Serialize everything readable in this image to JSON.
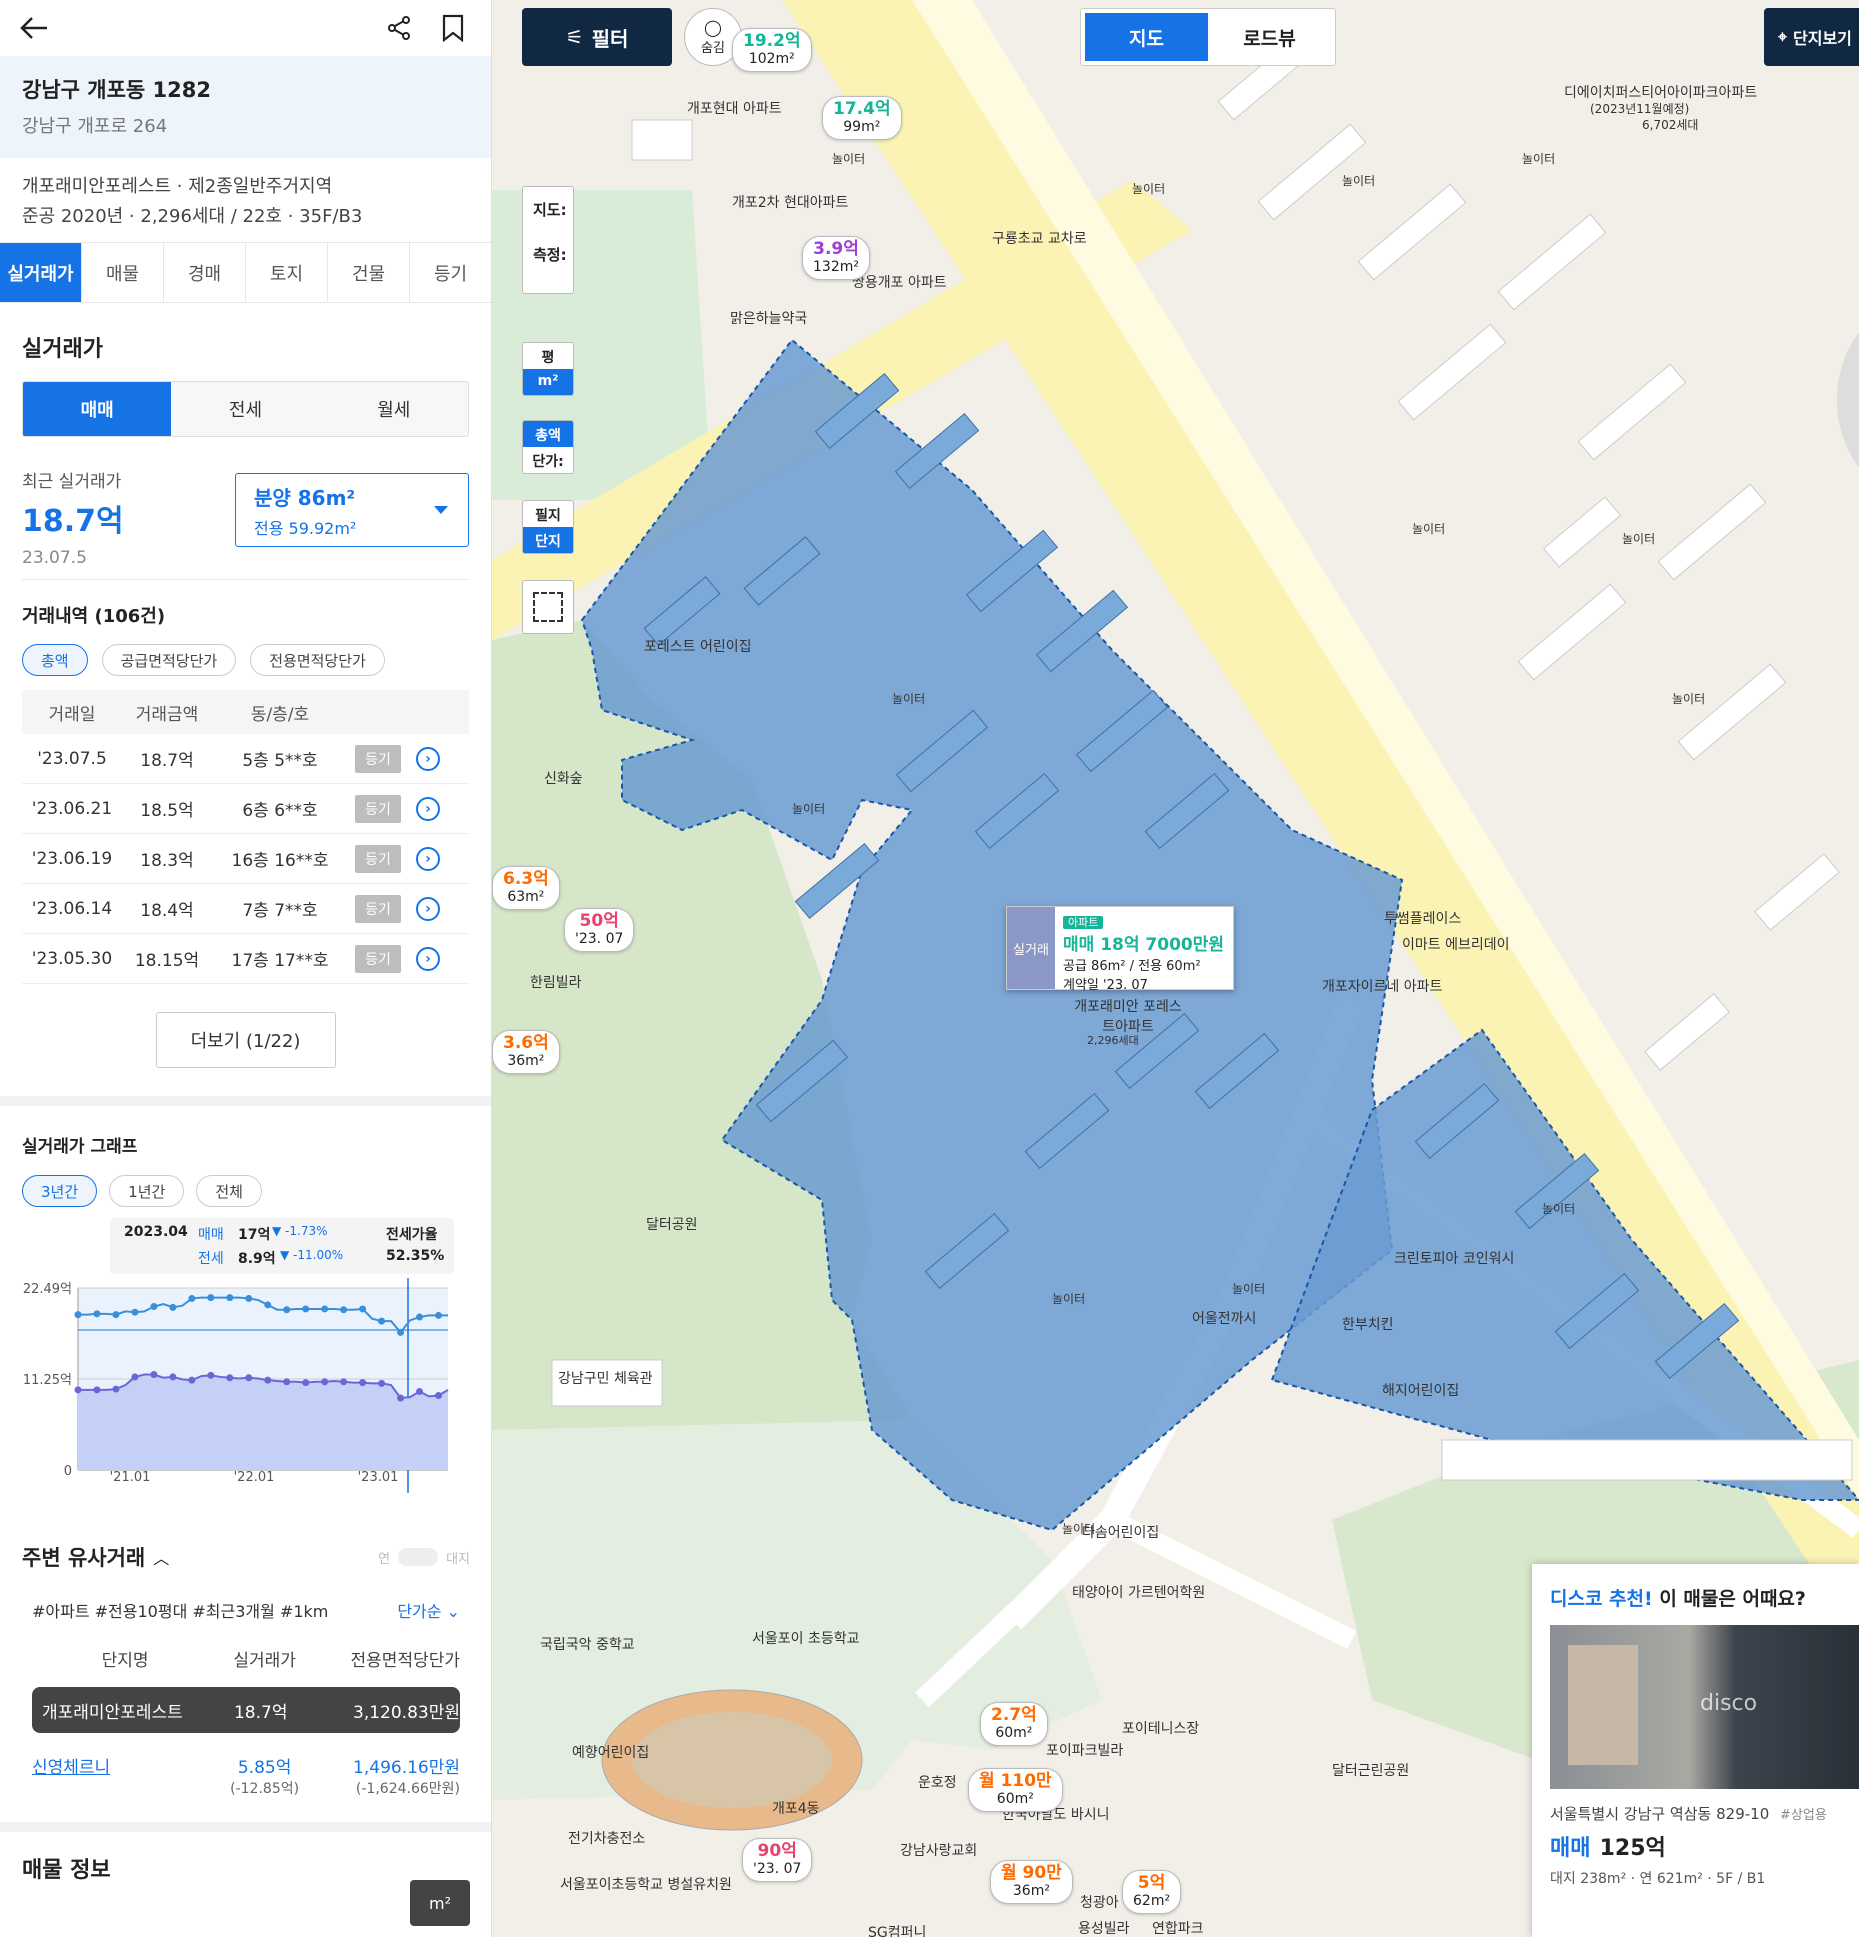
{
  "header": {
    "back_icon": "arrow-left",
    "share_icon": "share",
    "bookmark_icon": "bookmark"
  },
  "address": {
    "lot": "강남구 개포동 1282",
    "road": "강남구 개포로 264"
  },
  "info": {
    "line1": "개포래미안포레스트 · 제2종일반주거지역",
    "line2": "준공 2020년 · 2,296세대 / 22호 · 35F/B3"
  },
  "tabs": [
    "실거래가",
    "매물",
    "경매",
    "토지",
    "건물",
    "등기"
  ],
  "real_price": {
    "title": "실거래가",
    "types": [
      "매매",
      "전세",
      "월세"
    ],
    "recent_label": "최근 실거래가",
    "recent_value": "18.7억",
    "recent_date": "23.07.5",
    "area_supply": "분양 86m²",
    "area_exclusive": "전용 59.92m²"
  },
  "deals": {
    "title": "거래내역 (106건)",
    "filters": [
      "총액",
      "공급면적당단가",
      "전용면적당단가"
    ],
    "headers": [
      "거래일",
      "거래금액",
      "동/층/호"
    ],
    "reg_label": "등기",
    "rows": [
      {
        "date": "'23.07.5",
        "price": "18.7억",
        "unit": "5층 5**호"
      },
      {
        "date": "'23.06.21",
        "price": "18.5억",
        "unit": "6층 6**호"
      },
      {
        "date": "'23.06.19",
        "price": "18.3억",
        "unit": "16층 16**호"
      },
      {
        "date": "'23.06.14",
        "price": "18.4억",
        "unit": "7층 7**호"
      },
      {
        "date": "'23.05.30",
        "price": "18.15억",
        "unit": "17층 17**호"
      }
    ],
    "more": "더보기 (1/22)"
  },
  "graph": {
    "title": "실거래가 그래프",
    "periods": [
      "3년간",
      "1년간",
      "전체"
    ],
    "tooltip": {
      "date": "2023.04",
      "sale_label": "매매",
      "sale_value": "17억",
      "sale_change": "-1.73%",
      "jeonse_label": "전세",
      "jeonse_value": "8.9억",
      "jeonse_change": "-11.00%",
      "ratio_label": "전세가율",
      "ratio_value": "52.35%"
    },
    "y_ticks": [
      "22.49억",
      "11.25억",
      "0"
    ],
    "x_ticks": [
      "'21.01",
      "'22.01",
      "'23.01"
    ]
  },
  "chart_data": {
    "type": "line",
    "ylim": [
      0,
      22.49
    ],
    "series": [
      {
        "name": "매매",
        "values": [
          19.2,
          19.2,
          19.3,
          19.3,
          19.2,
          19.6,
          19.5,
          19.6,
          20.2,
          20.5,
          20.1,
          20.3,
          21.2,
          21.3,
          21.3,
          21.3,
          21.3,
          21.3,
          21.2,
          21.0,
          20.4,
          19.8,
          19.8,
          19.9,
          19.9,
          19.9,
          19.9,
          19.9,
          19.8,
          19.8,
          19.9,
          18.7,
          18.4,
          18.4,
          17.0,
          18.5,
          18.9,
          19.1,
          19.1,
          19.1
        ]
      },
      {
        "name": "전세",
        "values": [
          9.9,
          9.9,
          9.9,
          9.9,
          10.0,
          10.5,
          11.5,
          11.8,
          11.8,
          11.4,
          11.5,
          11.2,
          11.1,
          11.6,
          11.7,
          11.5,
          11.4,
          11.3,
          11.4,
          11.3,
          11.1,
          11.0,
          10.9,
          10.9,
          10.8,
          10.9,
          10.9,
          11.0,
          10.9,
          10.8,
          10.8,
          10.7,
          10.7,
          10.5,
          8.9,
          9.0,
          9.7,
          9.1,
          9.2,
          9.9
        ]
      }
    ]
  },
  "similar": {
    "title": "주변 유사거래",
    "toggle_l": "연",
    "toggle_r": "대지",
    "tags": "#아파트 #전용10평대 #최근3개월 #1km",
    "sort": "단가순",
    "headers": [
      "단지명",
      "실거래가",
      "전용면적당단가"
    ],
    "row1": {
      "name": "개포래미안포레스트",
      "price": "18.7억",
      "unit": "3,120.83만원"
    },
    "row2": {
      "name": "신영체르니",
      "price": "5.85억",
      "price_sub": "(-12.85억)",
      "unit": "1,496.16만원",
      "unit_sub": "(-1,624.66만원)"
    }
  },
  "listing": {
    "title": "매물 정보",
    "area_toggle": "m²"
  },
  "map": {
    "filter": "필터",
    "hide": "숨김",
    "view_map": "지도",
    "view_road": "로드뷰",
    "complex_btn": "단지보기",
    "ctrl_map": "지도:",
    "ctrl_measure": "측정:",
    "ctrl_pyeong": "평",
    "ctrl_m2": "m²",
    "ctrl_total": "총액",
    "ctrl_unit": "단가:",
    "ctrl_lot": "필지",
    "ctrl_complex": "단지",
    "popup": {
      "tag": "아파트",
      "side": "실거래",
      "title": "매매 18억 7000만원",
      "area": "공급 86m² / 전용 60m²",
      "date": "계약일 '23. 07"
    },
    "complex_name": "개포래미안 포레스트아파트",
    "complex_units": "2,296세대",
    "pins": [
      {
        "p1": "19.2억",
        "p2": "102m²"
      },
      {
        "p1": "17.4억",
        "p2": "99m²"
      },
      {
        "p1": "3.9억",
        "p2": "132m²"
      },
      {
        "p1": "6.3억",
        "p2": "63m²"
      },
      {
        "p1": "50억",
        "p2": "'23. 07"
      },
      {
        "p1": "3.6억",
        "p2": "36m²"
      },
      {
        "p1": "2.7억",
        "p2": "60m²"
      },
      {
        "p1": "월 110만",
        "p2": "60m²"
      },
      {
        "p1": "90억",
        "p2": "'23. 07"
      },
      {
        "p1": "월 90만",
        "p2": "36m²"
      },
      {
        "p1": "5억",
        "p2": "62m²"
      }
    ],
    "labels": {
      "dongs": [
        "개포현대 아파트",
        "개포2차 현대아파트",
        "쌍용개포 아파트",
        "맑은하늘약국",
        "구룡초교 교차로",
        "신화숲",
        "달터공원",
        "강남구민 체육관",
        "국립국악 중학교",
        "서울포이 초등학교",
        "예향어린이집",
        "전기차충전소",
        "개포4동",
        "서울포이초등학교 병설유치원",
        "포이테니스장",
        "달터근린공원",
        "투썸플레이스",
        "이마트 에브리데이",
        "개포자이르네 아파트",
        "크린토피아 코인워시",
        "한부치킨",
        "해지어린이집",
        "다솜어린이집",
        "태양아이 가르텐어학원",
        "어울전까시",
        "포레스트 어린이집",
        "한림빌라",
        "포이파크빌라",
        "한국아날도 바시니",
        "강남사랑교회",
        "청광아",
        "용성빌라",
        "연합파크",
        "SG컴퍼니",
        "운호정",
        "놀이터",
        "디에이치퍼스티어아이파크아파트",
        "(2023년11월예정)",
        "6,702세대"
      ]
    },
    "reco": {
      "title_a": "디스코 추천!",
      "title_b": "이 매물은 어때요?",
      "addr": "서울특별시 강남구 역삼동 829-10",
      "tag": "#상업용",
      "type": "매매",
      "price": "125억",
      "spec": "대지 238m²  ·  연 621m²  ·  5F / B1",
      "watermark": "disco"
    }
  }
}
